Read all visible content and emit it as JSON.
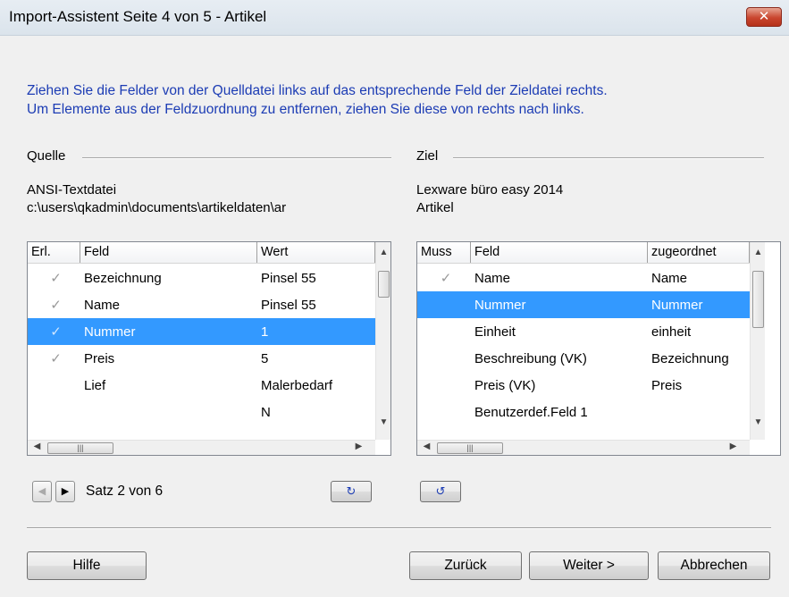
{
  "window": {
    "title": "Import-Assistent Seite 4 von 5 - Artikel",
    "close_label": "✕"
  },
  "instructions": {
    "line1": "Ziehen Sie die Felder von der Quelldatei links auf das entsprechende Feld der Zieldatei rechts.",
    "line2": "Um Elemente aus der Feldzuordnung zu entfernen, ziehen Sie diese von rechts nach links."
  },
  "source": {
    "label": "Quelle",
    "type": "ANSI-Textdatei",
    "path": "c:\\users\\qkadmin\\documents\\artikeldaten\\ar",
    "columns": [
      "Erl.",
      "Feld",
      "Wert"
    ],
    "rows": [
      {
        "done": "✓",
        "field": "Bezeichnung",
        "value": "Pinsel 55",
        "selected": false
      },
      {
        "done": "✓",
        "field": "Name",
        "value": "Pinsel 55",
        "selected": false
      },
      {
        "done": "✓",
        "field": "Nummer",
        "value": "1",
        "selected": true
      },
      {
        "done": "✓",
        "field": "Preis",
        "value": "5",
        "selected": false
      },
      {
        "done": "",
        "field": "Lief",
        "value": "Malerbedarf",
        "selected": false
      },
      {
        "done": "",
        "field": "",
        "value": "N",
        "selected": false
      }
    ]
  },
  "target": {
    "label": "Ziel",
    "product": "Lexware büro easy 2014",
    "table": "Artikel",
    "columns": [
      "Muss",
      "Feld",
      "zugeordnet"
    ],
    "rows": [
      {
        "required": "✓",
        "field": "Name",
        "assigned": "Name",
        "selected": false
      },
      {
        "required": "",
        "field": "Nummer",
        "assigned": "Nummer",
        "selected": true
      },
      {
        "required": "",
        "field": "Einheit",
        "assigned": "einheit",
        "selected": false
      },
      {
        "required": "",
        "field": "Beschreibung (VK)",
        "assigned": "Bezeichnung",
        "selected": false
      },
      {
        "required": "",
        "field": "Preis (VK)",
        "assigned": "Preis",
        "selected": false
      },
      {
        "required": "",
        "field": "Benutzerdef.Feld 1",
        "assigned": "",
        "selected": false
      }
    ]
  },
  "record_nav": {
    "text": "Satz 2 von 6"
  },
  "buttons": {
    "help": "Hilfe",
    "back": "Zurück",
    "next": "Weiter >",
    "cancel": "Abbrechen"
  },
  "colors": {
    "instruction_text": "#1c3cb4",
    "selection": "#3399ff",
    "close_button": "#c9452e"
  }
}
